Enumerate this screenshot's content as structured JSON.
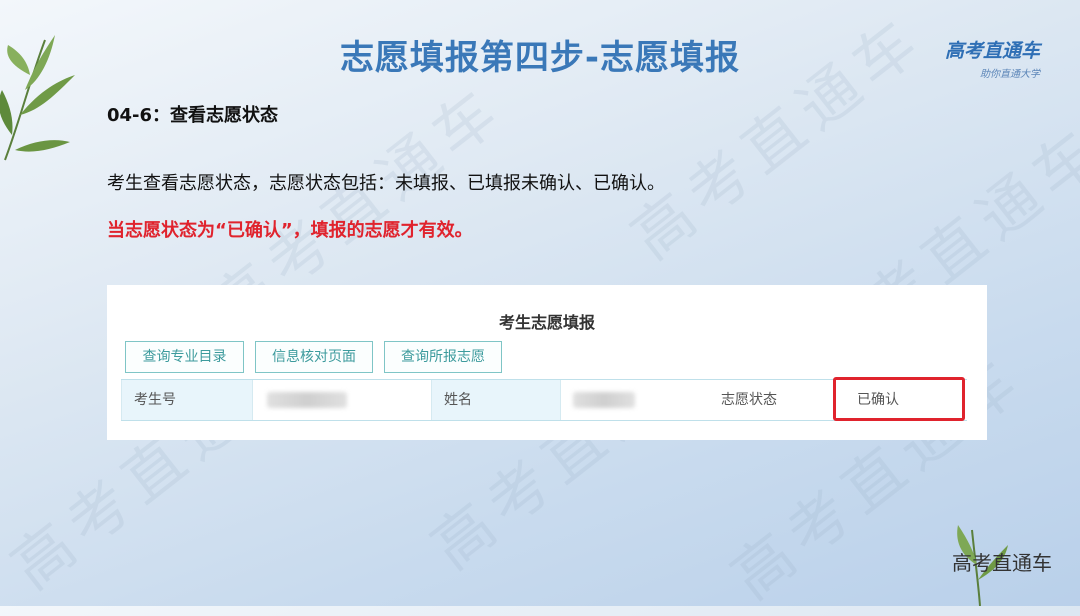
{
  "header": {
    "title": "志愿填报第四步-志愿填报",
    "brand_name": "高考直通车",
    "brand_slogan": "助你直通大学"
  },
  "content": {
    "subheading": "04-6：查看志愿状态",
    "description": "考生查看志愿状态，志愿状态包括：未填报、已填报未确认、已确认。",
    "warning": "当志愿状态为“已确认”，填报的志愿才有效。"
  },
  "panel": {
    "title": "考生志愿填报",
    "buttons": [
      "查询专业目录",
      "信息核对页面",
      "查询所报志愿"
    ],
    "fields": {
      "exam_number_label": "考生号",
      "name_label": "姓名",
      "status_label": "志愿状态",
      "status_value": "已确认"
    }
  },
  "footer": {
    "brand": "高考直通车"
  },
  "watermark_text": "高考直通车",
  "colors": {
    "title": "#3a78b8",
    "warning": "#e0232d",
    "button_border": "#7fc5c6",
    "label_bg": "#e8f5fb"
  }
}
